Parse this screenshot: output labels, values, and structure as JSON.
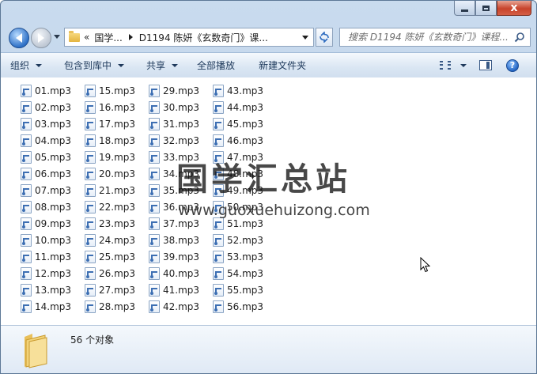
{
  "window": {
    "address": {
      "crumbs": [
        "国学...",
        "D1194 陈妍《玄数奇门》课..."
      ],
      "prefix": "«"
    },
    "search": {
      "placeholder": "搜索 D1194 陈妍《玄数奇门》课程..."
    },
    "caption": {
      "close": "x"
    }
  },
  "toolbar": {
    "organize": "组织",
    "include_in_library": "包含到库中",
    "share": "共享",
    "play_all": "全部播放",
    "new_folder": "新建文件夹",
    "help": "?"
  },
  "files": [
    "01.mp3",
    "02.mp3",
    "03.mp3",
    "04.mp3",
    "05.mp3",
    "06.mp3",
    "07.mp3",
    "08.mp3",
    "09.mp3",
    "10.mp3",
    "11.mp3",
    "12.mp3",
    "13.mp3",
    "14.mp3",
    "15.mp3",
    "16.mp3",
    "17.mp3",
    "18.mp3",
    "19.mp3",
    "20.mp3",
    "21.mp3",
    "22.mp3",
    "23.mp3",
    "24.mp3",
    "25.mp3",
    "26.mp3",
    "27.mp3",
    "28.mp3",
    "29.mp3",
    "30.mp3",
    "31.mp3",
    "32.mp3",
    "33.mp3",
    "34.mp3",
    "35.mp3",
    "36.mp3",
    "37.mp3",
    "38.mp3",
    "39.mp3",
    "40.mp3",
    "41.mp3",
    "42.mp3",
    "43.mp3",
    "44.mp3",
    "45.mp3",
    "46.mp3",
    "47.mp3",
    "48.mp3",
    "49.mp3",
    "50.mp3",
    "51.mp3",
    "52.mp3",
    "53.mp3",
    "54.mp3",
    "55.mp3",
    "56.mp3"
  ],
  "watermark": {
    "title": "国学汇总站",
    "url": "www.guoxuehuizong.com"
  },
  "details": {
    "count": "56 个对象"
  },
  "colors": {
    "accent": "#2f71c7",
    "folder": "#e4b43f",
    "close_button": "#c7432b"
  }
}
